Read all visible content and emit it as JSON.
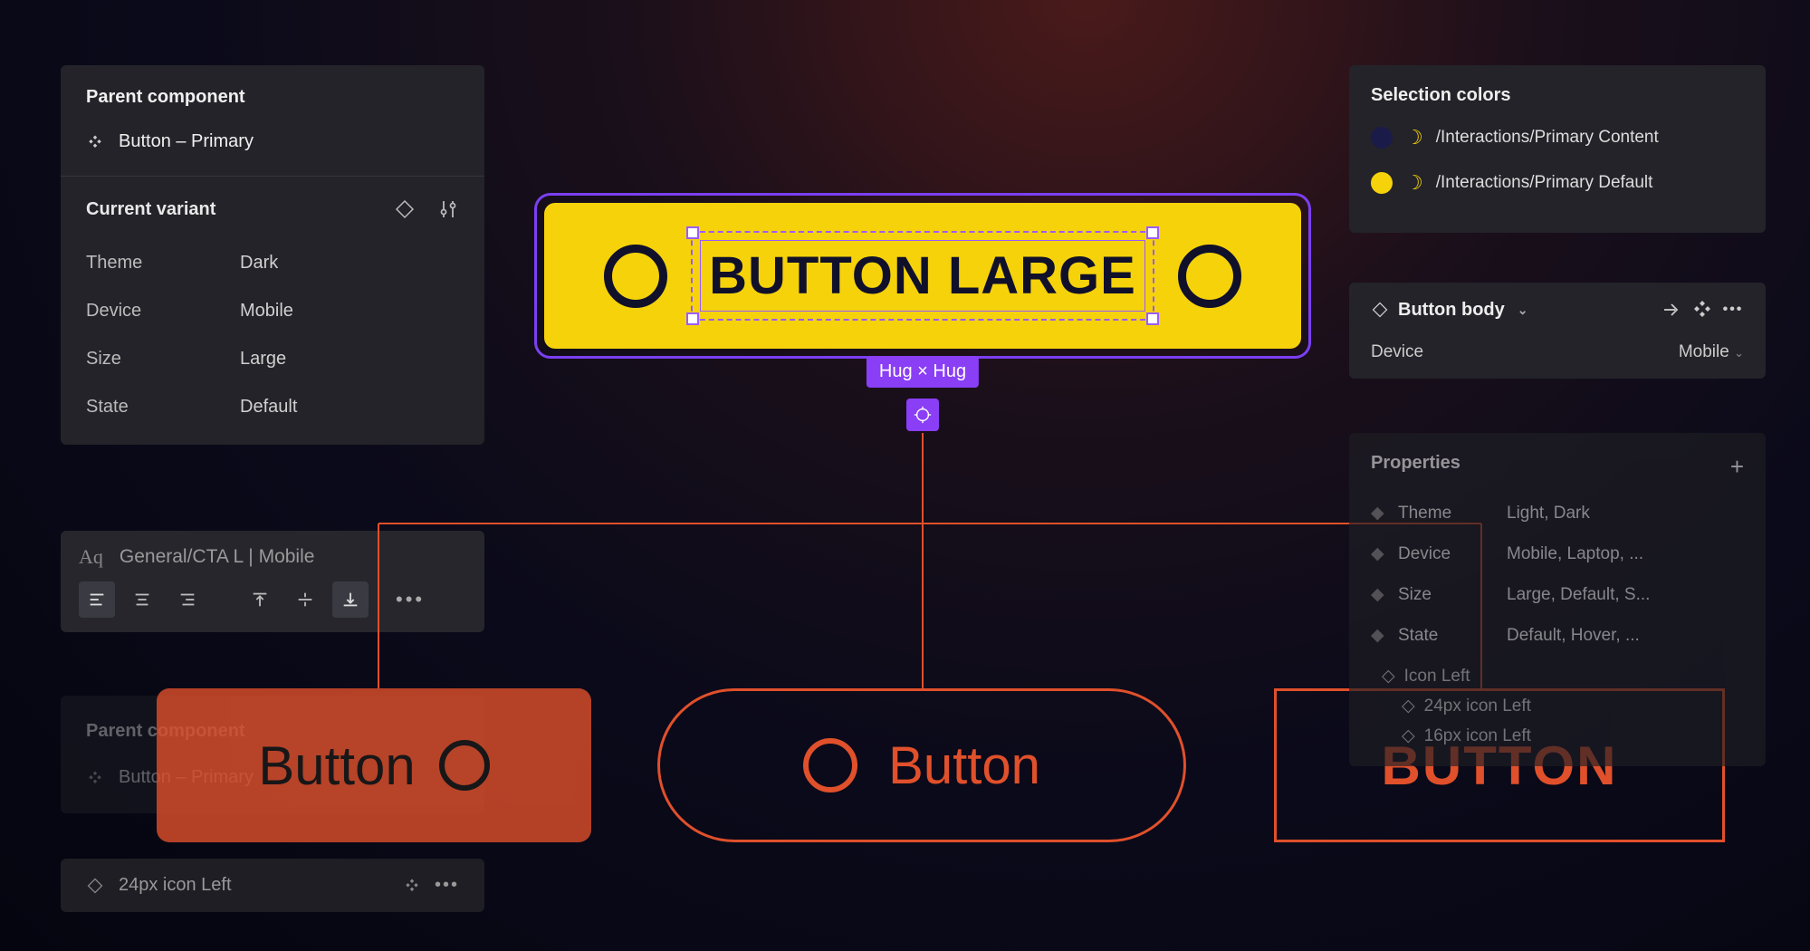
{
  "left_parent": {
    "heading": "Parent component",
    "component_name": "Button – Primary",
    "variant_heading": "Current variant",
    "variants": {
      "theme_label": "Theme",
      "theme_value": "Dark",
      "device_label": "Device",
      "device_value": "Mobile",
      "size_label": "Size",
      "size_value": "Large",
      "state_label": "State",
      "state_value": "Default"
    }
  },
  "text_style": {
    "icon_text": "Aq",
    "name": "General/CTA L | Mobile"
  },
  "left_parent_2": {
    "heading": "Parent component",
    "component_name": "Button – Primary"
  },
  "icon_left_row": {
    "label": "24px icon Left"
  },
  "center": {
    "button_text": "BUTTON LARGE",
    "hug_label": "Hug × Hug"
  },
  "right_colors": {
    "heading": "Selection colors",
    "row1_swatch": "#1b1b4a",
    "row1_label": "/Interactions/Primary Content",
    "row2_swatch": "#f5d20a",
    "row2_label": "/Interactions/Primary Default"
  },
  "right_layer": {
    "layer_name": "Button body",
    "device_label": "Device",
    "device_value": "Mobile"
  },
  "right_props": {
    "heading": "Properties",
    "rows": [
      {
        "name": "Theme",
        "values": "Light, Dark"
      },
      {
        "name": "Device",
        "values": "Mobile, Laptop, ..."
      },
      {
        "name": "Size",
        "values": "Large, Default, S..."
      },
      {
        "name": "State",
        "values": "Default, Hover, ..."
      }
    ],
    "icon_left_1": "Icon Left",
    "icon_left_2": "24px icon Left",
    "icon_left_3": "16px icon Left"
  },
  "bottom_buttons": {
    "b1": "Button",
    "b2": "Button",
    "b3": "BUTTON"
  }
}
